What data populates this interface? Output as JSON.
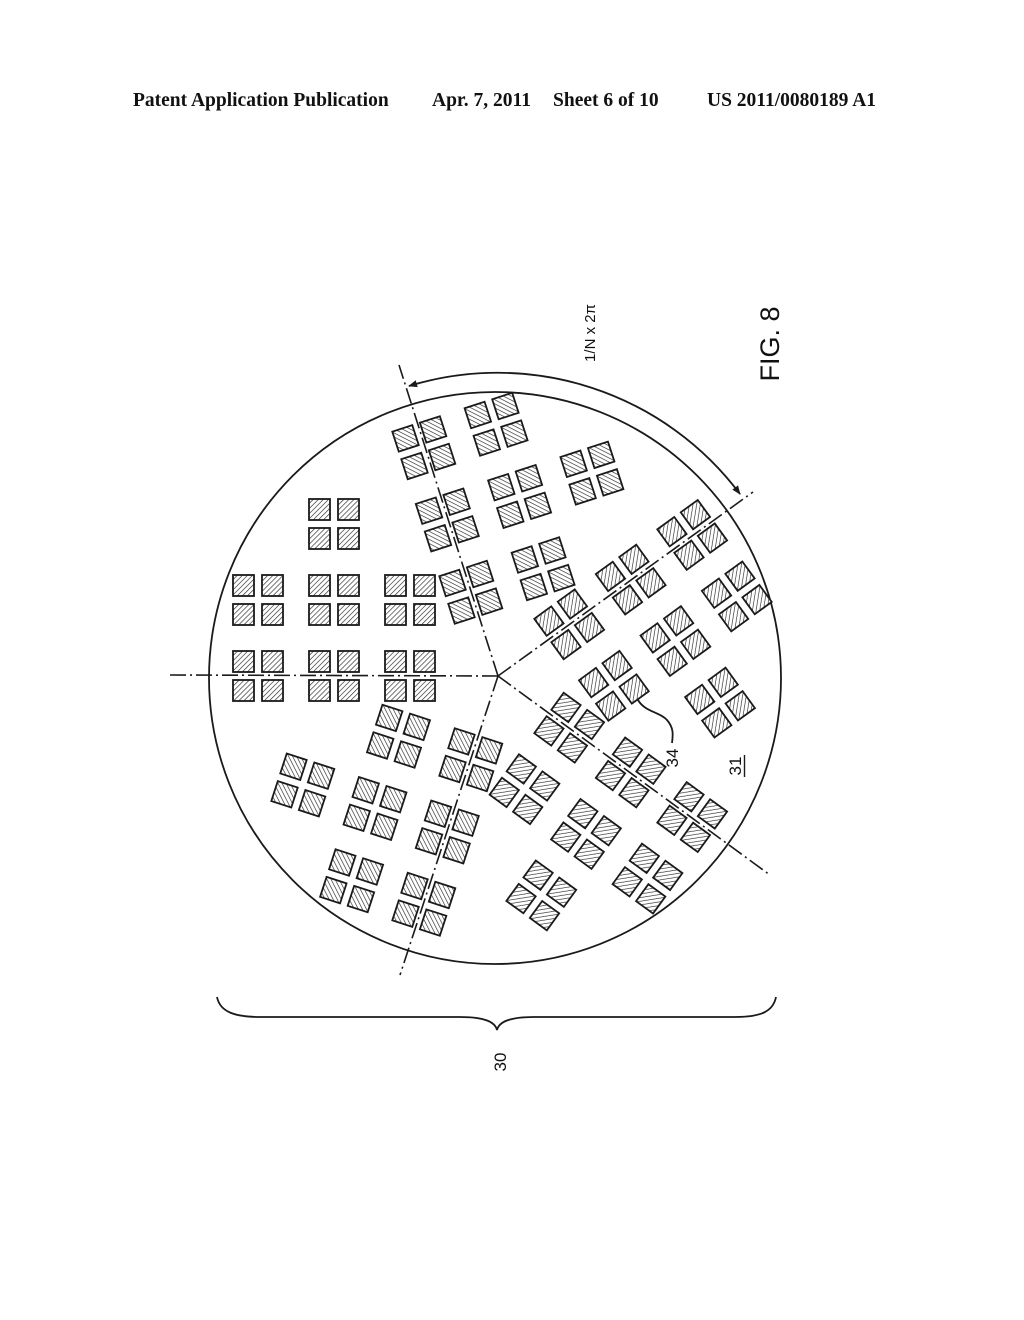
{
  "header": {
    "publication": "Patent Application Publication",
    "date": "Apr. 7, 2011",
    "sheet": "Sheet 6 of 10",
    "number": "US 2011/0080189 A1"
  },
  "figure": {
    "label": "FIG. 8",
    "angle_label": "1/N x 2π",
    "sector_count": 5,
    "blocks_per_sector": 7,
    "dies_per_block": 4,
    "reference_numerals": {
      "wafer": "30",
      "substrate": "31",
      "die": "34"
    }
  },
  "colors": {
    "ink": "#1a1a1a",
    "paper": "#ffffff"
  }
}
